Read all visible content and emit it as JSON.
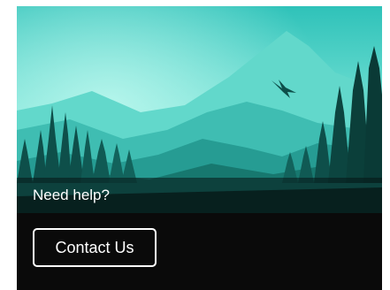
{
  "help": {
    "text": "Need help?"
  },
  "contact": {
    "label": "Contact Us"
  },
  "colors": {
    "sky_light": "#8ff0e0",
    "sky_mid": "#39c9c0",
    "mountain_far": "#56d3c7",
    "forest_dark": "#0e5a55",
    "bar_background": "#0a0a0a",
    "text": "#ffffff"
  },
  "icons": {
    "bird": "bird-icon"
  }
}
